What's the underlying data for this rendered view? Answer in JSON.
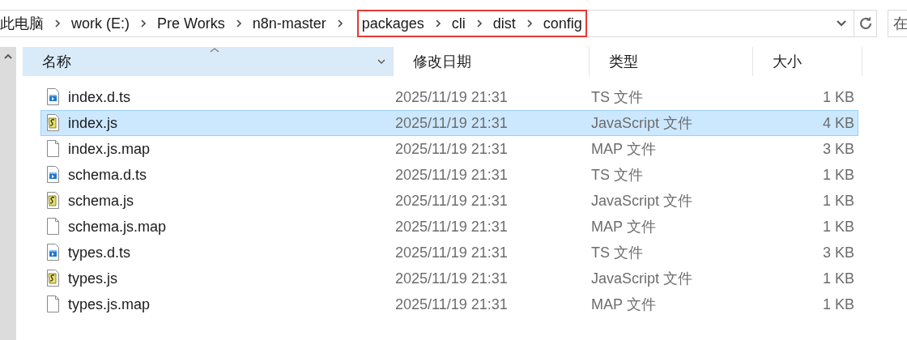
{
  "address": {
    "breadcrumbs": [
      {
        "label": "此电脑",
        "highlighted": false
      },
      {
        "label": "work (E:)",
        "highlighted": false
      },
      {
        "label": "Pre Works",
        "highlighted": false
      },
      {
        "label": "n8n-master",
        "highlighted": false
      },
      {
        "label": "packages",
        "highlighted": true
      },
      {
        "label": "cli",
        "highlighted": true
      },
      {
        "label": "dist",
        "highlighted": true
      },
      {
        "label": "config",
        "highlighted": true
      }
    ]
  },
  "search": {
    "placeholder": "在"
  },
  "table": {
    "columns": [
      {
        "label": "名称",
        "sorted": true
      },
      {
        "label": "修改日期",
        "sorted": false
      },
      {
        "label": "类型",
        "sorted": false
      },
      {
        "label": "大小",
        "sorted": false
      }
    ],
    "rows": [
      {
        "name": "index.d.ts",
        "kind": "ts",
        "modified": "2025/11/19 21:31",
        "type": "TS 文件",
        "size": "1 KB",
        "selected": false
      },
      {
        "name": "index.js",
        "kind": "js",
        "modified": "2025/11/19 21:31",
        "type": "JavaScript 文件",
        "size": "4 KB",
        "selected": true
      },
      {
        "name": "index.js.map",
        "kind": "map",
        "modified": "2025/11/19 21:31",
        "type": "MAP 文件",
        "size": "3 KB",
        "selected": false
      },
      {
        "name": "schema.d.ts",
        "kind": "ts",
        "modified": "2025/11/19 21:31",
        "type": "TS 文件",
        "size": "1 KB",
        "selected": false
      },
      {
        "name": "schema.js",
        "kind": "js",
        "modified": "2025/11/19 21:31",
        "type": "JavaScript 文件",
        "size": "1 KB",
        "selected": false
      },
      {
        "name": "schema.js.map",
        "kind": "map",
        "modified": "2025/11/19 21:31",
        "type": "MAP 文件",
        "size": "1 KB",
        "selected": false
      },
      {
        "name": "types.d.ts",
        "kind": "ts",
        "modified": "2025/11/19 21:31",
        "type": "TS 文件",
        "size": "3 KB",
        "selected": false
      },
      {
        "name": "types.js",
        "kind": "js",
        "modified": "2025/11/19 21:31",
        "type": "JavaScript 文件",
        "size": "1 KB",
        "selected": false
      },
      {
        "name": "types.js.map",
        "kind": "map",
        "modified": "2025/11/19 21:31",
        "type": "MAP 文件",
        "size": "1 KB",
        "selected": false
      }
    ]
  }
}
